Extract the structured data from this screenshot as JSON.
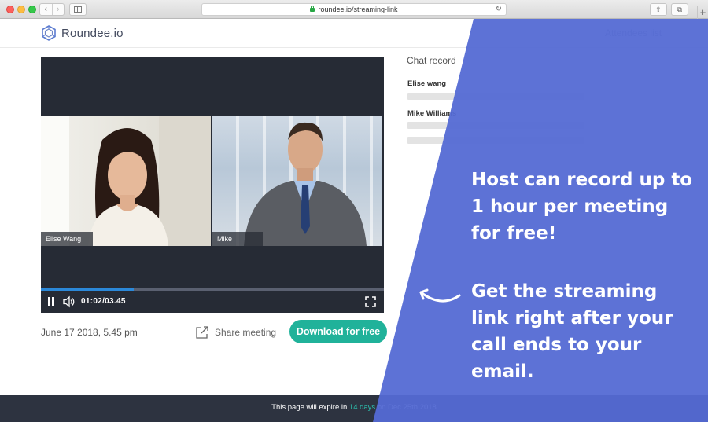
{
  "browser": {
    "url": "roundee.io/streaming-link",
    "nav_back": "‹",
    "nav_forward": "›",
    "reload_glyph": "↻",
    "share_glyph": "⇧",
    "tabs_glyph": "⧉",
    "newtab_glyph": "+"
  },
  "header": {
    "logo_text": "Roundee.io",
    "attendees_link": "Attendees list"
  },
  "player": {
    "participants": [
      {
        "name": "Elise Wang"
      },
      {
        "name": "Mike"
      }
    ],
    "time": "01:02/03.45",
    "progress_fraction": 0.27
  },
  "meeting": {
    "date": "June 17 2018, 5.45 pm",
    "share_label": "Share meeting",
    "download_label": "Download for free"
  },
  "chat": {
    "title": "Chat record",
    "entries": [
      {
        "name": "Elise wang"
      },
      {
        "name": "Mike Williams"
      }
    ]
  },
  "footer": {
    "prefix": "This page will expire in ",
    "highlight": "14 days",
    "suffix": " on Dec 25th 2018"
  },
  "promo": {
    "line1": "Host can record up to 1 hour per meeting for free!",
    "line2": "Get the streaming link right after your call ends to your email."
  },
  "colors": {
    "overlay": "#546ad4",
    "accent": "#20b29a",
    "footer": "#2d3340",
    "player": "#262b35"
  }
}
